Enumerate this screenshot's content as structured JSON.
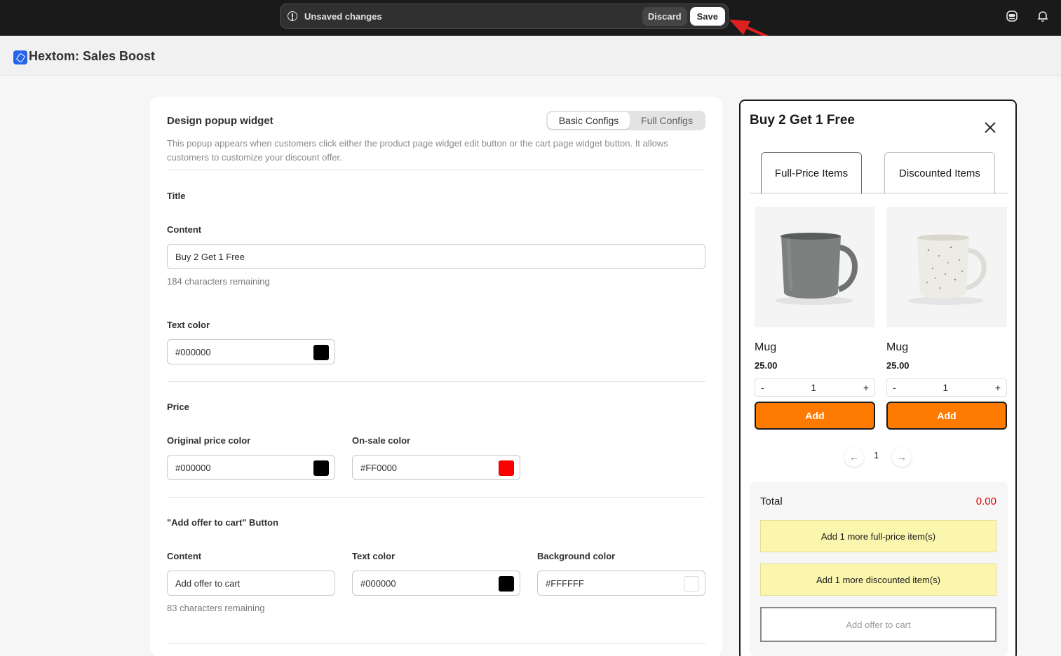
{
  "save_bar": {
    "message": "Unsaved changes",
    "discard_label": "Discard",
    "save_label": "Save"
  },
  "app": {
    "title": "Hextom: Sales Boost"
  },
  "editor": {
    "title": "Design popup widget",
    "tabs": [
      {
        "label": "Basic Configs",
        "active": true
      },
      {
        "label": "Full Configs",
        "active": false
      }
    ],
    "description": "This popup appears when customers click either the product page widget edit button or the cart page widget button. It allows customers to customize your discount offer.",
    "title_section": {
      "heading": "Title",
      "content_label": "Content",
      "content_value": "Buy 2 Get 1 Free",
      "content_hint": "184 characters remaining",
      "text_color_label": "Text color",
      "text_color_value": "#000000"
    },
    "price_section": {
      "heading": "Price",
      "original_label": "Original price color",
      "original_value": "#000000",
      "onsale_label": "On-sale color",
      "onsale_value": "#FF0000"
    },
    "button_section": {
      "heading": "\"Add offer to cart\" Button",
      "content_label": "Content",
      "content_value": "Add offer to cart",
      "content_hint": "83 characters remaining",
      "text_color_label": "Text color",
      "text_color_value": "#000000",
      "bg_color_label": "Background color",
      "bg_color_value": "#FFFFFF"
    }
  },
  "preview": {
    "title": "Buy 2 Get 1 Free",
    "tabs": [
      "Full-Price Items",
      "Discounted Items"
    ],
    "products": [
      {
        "name": "Mug",
        "price": "25.00",
        "qty": "1",
        "minus": "-",
        "plus": "+",
        "add_label": "Add",
        "image": "grey-mug"
      },
      {
        "name": "Mug",
        "price": "25.00",
        "qty": "1",
        "minus": "-",
        "plus": "+",
        "add_label": "Add",
        "image": "speckled-white-mug"
      }
    ],
    "pager": {
      "prev": "←",
      "page": "1",
      "next": "→"
    },
    "total_label": "Total",
    "total_value": "0.00",
    "notes": [
      "Add 1 more full-price item(s)",
      "Add 1 more discounted item(s)"
    ],
    "cart_button": "Add offer to cart"
  },
  "colors": {
    "accent_orange": "#FF7A00",
    "total_red": "#E00000",
    "note_yellow": "#FBF6AE",
    "annotation_arrow": "#E02020"
  }
}
